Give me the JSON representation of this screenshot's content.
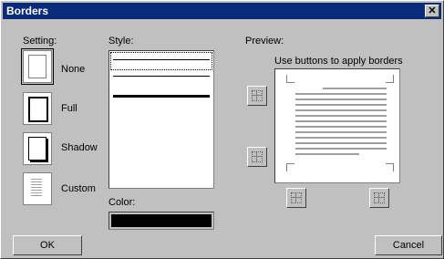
{
  "title": "Borders",
  "close_glyph": "✕",
  "setting": {
    "label": "Setting:",
    "options": [
      {
        "label": "None"
      },
      {
        "label": "Full"
      },
      {
        "label": "Shadow"
      },
      {
        "label": "Custom"
      }
    ]
  },
  "style": {
    "label": "Style:"
  },
  "color": {
    "label": "Color:",
    "value": "#000000"
  },
  "preview": {
    "label": "Preview:",
    "hint": "Use buttons to apply borders"
  },
  "buttons": {
    "ok": "OK",
    "cancel": "Cancel"
  }
}
